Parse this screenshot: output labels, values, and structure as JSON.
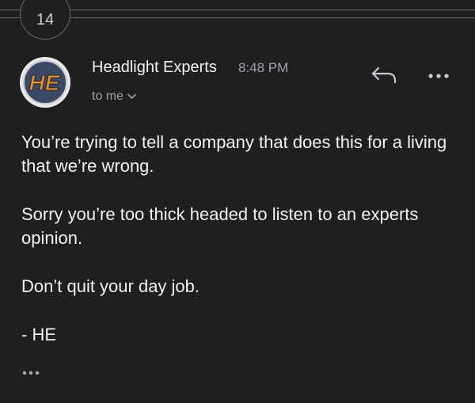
{
  "thread": {
    "message_count": "14"
  },
  "message": {
    "sender": "Headlight Experts",
    "time": "8:48 PM",
    "recipient": "to me",
    "avatar_text": "HE",
    "body": [
      "You’re trying to tell a company that does this for a living that we’re wrong.",
      "Sorry you’re too thick headed to listen to an experts opinion.",
      "Don’t quit your day job.",
      "- HE"
    ]
  },
  "icons": {
    "reply": "reply-icon",
    "more": "more-horizontal-icon",
    "recipient_expand": "chevron-down-icon",
    "quoted_text": "ellipsis-icon"
  },
  "colors": {
    "background": "#1f1f21",
    "text": "#f2f2f2",
    "secondary_text": "#a3a3a8",
    "avatar_orange": "#f0921c",
    "avatar_blue": "#3a4a66"
  }
}
